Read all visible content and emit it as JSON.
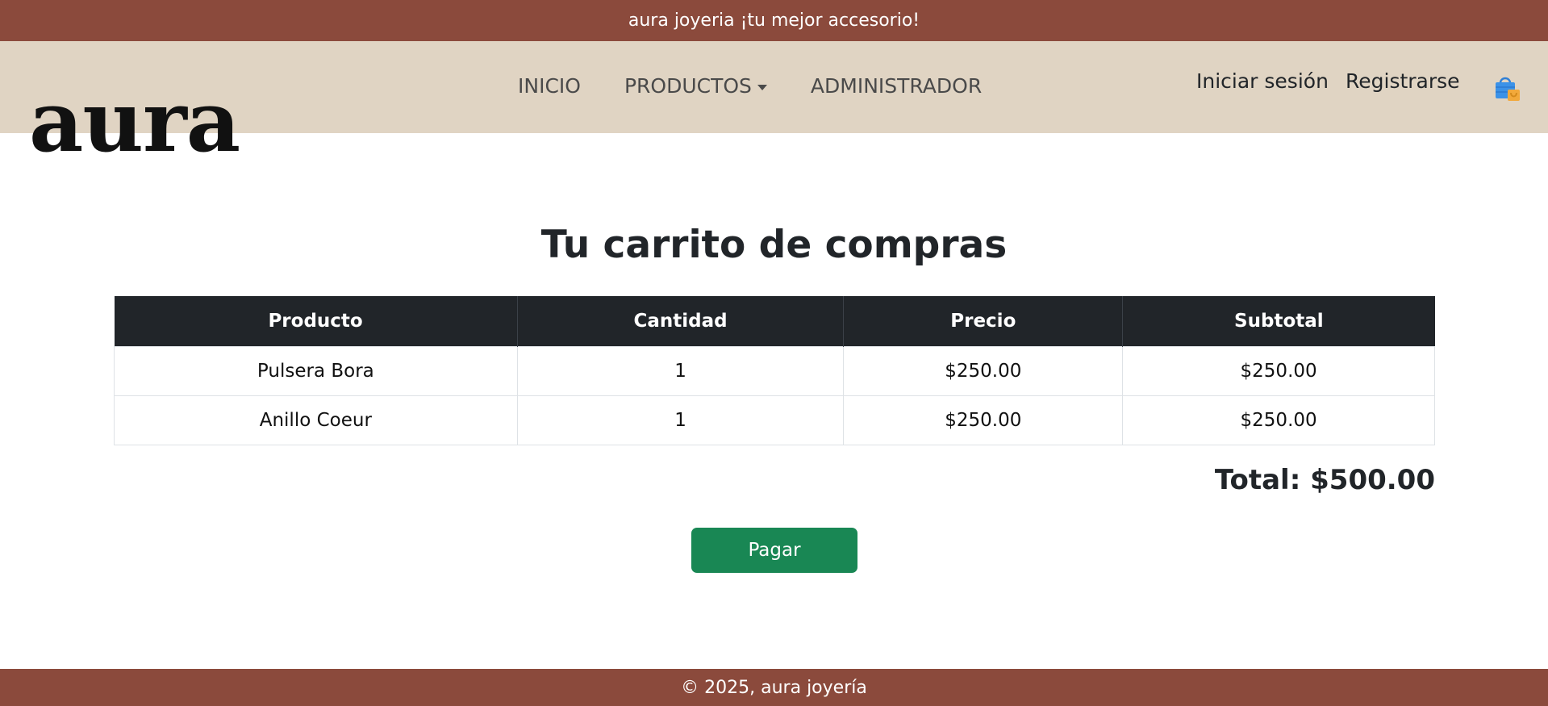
{
  "announcement": "aura joyeria ¡tu mejor accesorio!",
  "brand": {
    "logo_text": "aura"
  },
  "nav": {
    "items": [
      {
        "label": "INICIO"
      },
      {
        "label": "PRODUCTOS"
      },
      {
        "label": "ADMINISTRADOR"
      }
    ],
    "login": "Iniciar sesión",
    "register": "Registrarse",
    "cart_icon": "shopping-bag-icon"
  },
  "cart": {
    "title": "Tu carrito de compras",
    "columns": [
      "Producto",
      "Cantidad",
      "Precio",
      "Subtotal"
    ],
    "rows": [
      {
        "producto": "Pulsera Bora",
        "cantidad": "1",
        "precio": "$250.00",
        "subtotal": "$250.00"
      },
      {
        "producto": "Anillo Coeur",
        "cantidad": "1",
        "precio": "$250.00",
        "subtotal": "$250.00"
      }
    ],
    "total": "Total: $500.00",
    "pay_label": "Pagar"
  },
  "footer": {
    "text": "© 2025, aura joyería"
  },
  "colors": {
    "accent_brown": "#8b4a3c",
    "nav_background": "#e0d4c3",
    "table_header": "#212529",
    "pay_green": "#198754"
  }
}
